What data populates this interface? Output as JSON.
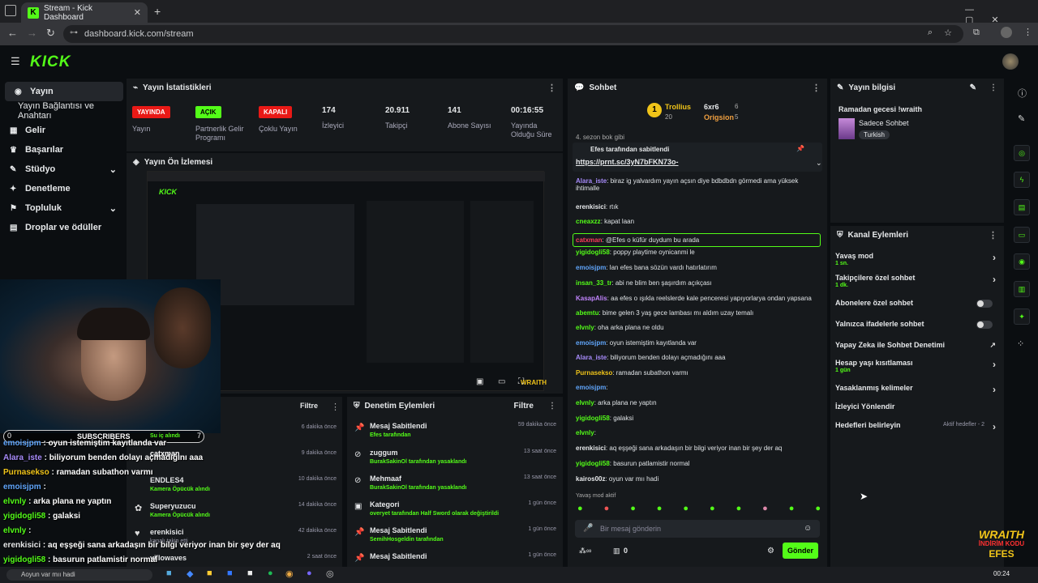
{
  "browser": {
    "tab_title": "Stream - Kick Dashboard",
    "url": "dashboard.kick.com/stream"
  },
  "sidebar": {
    "items": [
      {
        "label": "Yayın"
      },
      {
        "label": "Yayın Bağlantısı ve Anahtarı"
      },
      {
        "label": "Gelir"
      },
      {
        "label": "Başarılar"
      },
      {
        "label": "Stüdyo"
      },
      {
        "label": "Denetleme"
      },
      {
        "label": "Topluluk"
      },
      {
        "label": "Droplar ve ödüller"
      }
    ]
  },
  "stats": {
    "title": "Yayın İstatistikleri",
    "cols": [
      {
        "value": "YAYINDA",
        "label": "Yayın"
      },
      {
        "value": "AÇIK",
        "label": "Partnerlik Gelir Programı"
      },
      {
        "value": "KAPALI",
        "label": "Çoklu Yayın"
      },
      {
        "value": "174",
        "label": "İzleyici"
      },
      {
        "value": "20.911",
        "label": "Takipçi"
      },
      {
        "value": "141",
        "label": "Abone Sayısı"
      },
      {
        "value": "00:16:55",
        "label": "Yayında Olduğu Süre"
      }
    ]
  },
  "preview": {
    "title": "Yayın Ön İzlemesi"
  },
  "chat": {
    "title": "Sohbet",
    "leaders": [
      {
        "name": "Trollius",
        "count": "20",
        "extra": "6"
      },
      {
        "name": "6xr6",
        "count": "6"
      },
      {
        "name": "Origsion",
        "count": "5"
      }
    ],
    "top_fragment": "4. sezon bok gibi",
    "pinned_by": "Efes tarafından sabitlendi",
    "pinned_link": "https://prnt.sc/3yN7bFKN73o-",
    "messages": [
      {
        "user": "Alara_iste",
        "text": ": biraz ig yalvardım yayın açsın diye bdbdbdn görmedi ama yüksek ihtimalle",
        "color": "#a78bfa"
      },
      {
        "user": "erenkisici",
        "text": ": rtık",
        "color": "#e6e8ea"
      },
      {
        "user": "cneaxzz",
        "text": ": kapat laan",
        "color": "#53fc18"
      },
      {
        "user": "catxman",
        "text": ": @Efes o küfür duydum bu arada",
        "color": "#ff3b5c"
      },
      {
        "user": "yigidogli58",
        "text": ": poppy playtime oynicanmi le",
        "color": "#53fc18"
      },
      {
        "user": "emoisjpm",
        "text": ": lan efes bana sözün vardı hatırlatırım",
        "color": "#60a5fa"
      },
      {
        "user": "insan_33_tr",
        "text": ": abi ne blim ben şaşırdım açıkçası",
        "color": "#53fc18"
      },
      {
        "user": "KasapAlis",
        "text": ": aa efes o ışıkla reelslerde kale penceresi yapıyorlarya ondan yapsana",
        "color": "#c084fc"
      },
      {
        "user": "abemtu",
        "text": ": bime gelen 3 yaş gece lambası mı aldım uzay temalı",
        "color": "#53fc18"
      },
      {
        "user": "elvnly",
        "text": ": oha arka plana ne oldu",
        "color": "#53fc18"
      },
      {
        "user": "emoisjpm",
        "text": ": oyun istemiştim kayıtlanda var",
        "color": "#60a5fa"
      },
      {
        "user": "Alara_iste",
        "text": ": biliyorum benden dolayı açmadığını aaa",
        "color": "#a78bfa"
      },
      {
        "user": "Purnasekso",
        "text": ": ramadan subathon varmı",
        "color": "#f0c419"
      },
      {
        "user": "emoisjpm",
        "text": ":",
        "color": "#60a5fa"
      },
      {
        "user": "elvnly",
        "text": ": arka plana ne yaptın",
        "color": "#53fc18"
      },
      {
        "user": "yigidogli58",
        "text": ": galaksi",
        "color": "#53fc18"
      },
      {
        "user": "elvnly",
        "text": ":",
        "color": "#53fc18"
      },
      {
        "user": "erenkisici",
        "text": ": aq eşşeği sana arkadaşın bir bilgi veriyor inan bir şey der aq",
        "color": "#e6e8ea"
      },
      {
        "user": "yigidogli58",
        "text": ": basurun patlamistir normal",
        "color": "#53fc18"
      },
      {
        "user": "kairos00z",
        "text": ": oyun var mıı hadi",
        "color": "#e6e8ea"
      }
    ],
    "slow_mode": "Yavaş mod aktif",
    "input_placeholder": "Bir mesaj gönderin",
    "send_label": "Gönder",
    "points": "0"
  },
  "stream_info": {
    "title": "Yayın bilgisi",
    "stream_title": "Ramadan gecesi !wraith",
    "category": "Sadece Sohbet",
    "tag": "Turkish"
  },
  "channel_actions": {
    "title": "Kanal Eylemleri",
    "items": [
      {
        "label": "Yavaş mod",
        "sub": "1 sn."
      },
      {
        "label": "Takipçilere özel sohbet",
        "sub": "1 dk."
      },
      {
        "label": "Abonelere özel sohbet"
      },
      {
        "label": "Yalnızca ifadelerle sohbet"
      },
      {
        "label": "Yapay Zeka ile Sohbet Denetimi"
      },
      {
        "label": "Hesap yaşı kısıtlaması",
        "sub": "1 gün"
      },
      {
        "label": "Yasaklanmış kelimeler"
      },
      {
        "label": "İzleyici Yönlendir"
      },
      {
        "label": "Hedefleri belirleyin",
        "sub": "Aktif hedefler - 2"
      }
    ]
  },
  "activity": {
    "filter": "Filtre",
    "items": [
      {
        "name": "",
        "sub": "",
        "time": "6 dakika önce"
      },
      {
        "name": "",
        "sub": "",
        "time": "9 dakika önce"
      },
      {
        "name": "ENDLES4",
        "sub": "Kamera Öpücük alındı",
        "time": "10 dakika önce"
      },
      {
        "name": "Superyuzucu",
        "sub": "Kamera Öpücük alındı",
        "time": "14 dakika önce"
      },
      {
        "name": "erenkisici",
        "sub": "kanalı takip etti",
        "time": "42 dakika önce"
      },
      {
        "name": "yillowaves",
        "sub": "",
        "time": "2 saat önce"
      }
    ]
  },
  "mod_actions": {
    "title": "Denetim Eylemleri",
    "filter": "Filtre",
    "items": [
      {
        "name": "Mesaj Sabitlendi",
        "sub": "Efes tarafından",
        "time": "59 dakika önce"
      },
      {
        "name": "zuggum",
        "sub": "BurakSakinOl tarafından yasaklandı",
        "time": "13 saat önce"
      },
      {
        "name": "Mehmaaf",
        "sub": "BurakSakinOl tarafından yasaklandı",
        "time": "13 saat önce"
      },
      {
        "name": "Kategori",
        "sub": "overyet tarafından Half Sword olarak değiştirildi",
        "time": "1 gün önce"
      },
      {
        "name": "Mesaj Sabitlendi",
        "sub": "SemihHosgeldin tarafından",
        "time": "1 gün önce"
      },
      {
        "name": "Mesaj Sabitlendi",
        "sub": "",
        "time": "1 gün önce"
      }
    ]
  },
  "overlay": {
    "subs_label": "SUBSCRIBERS",
    "subs_left": "0",
    "subs_right": "7",
    "sub_note": "Su iç alındı",
    "lines": [
      {
        "user": "emoisjpm",
        "text": " : oyun istemiştim kayıtlanda var",
        "color": "#60a5fa"
      },
      {
        "user": "Alara_iste",
        "text": " : biliyorum benden dolayı açmadığını aaa",
        "color": "#a78bfa"
      },
      {
        "user": "Purnasekso",
        "text": " : ramadan subathon varmı",
        "color": "#f0c419"
      },
      {
        "user": "emoisjpm",
        "text": " :",
        "color": "#60a5fa"
      },
      {
        "user": "elvnly",
        "text": " : arka plana ne yaptın",
        "color": "#53fc18"
      },
      {
        "user": "yigidogli58",
        "text": " : galaksi",
        "color": "#53fc18"
      },
      {
        "user": "elvnly",
        "text": " :",
        "color": "#53fc18"
      },
      {
        "user": "erenkisici",
        "text": " : aq eşşeği sana arkadaşın bir bilgi veriyor inan bir şey der aq",
        "color": "#e6e8ea"
      },
      {
        "user": "yigidogli58",
        "text": " : basurun patlamistir normal",
        "color": "#53fc18"
      }
    ],
    "catxman": "catxman",
    "taskbar_text": "Aoyun var mıı hadi"
  },
  "brand": {
    "line1": "WRAITH",
    "line2": "İNDİRİM KODU",
    "line3": "EFES"
  },
  "taskbar": {
    "time": "00:24"
  }
}
